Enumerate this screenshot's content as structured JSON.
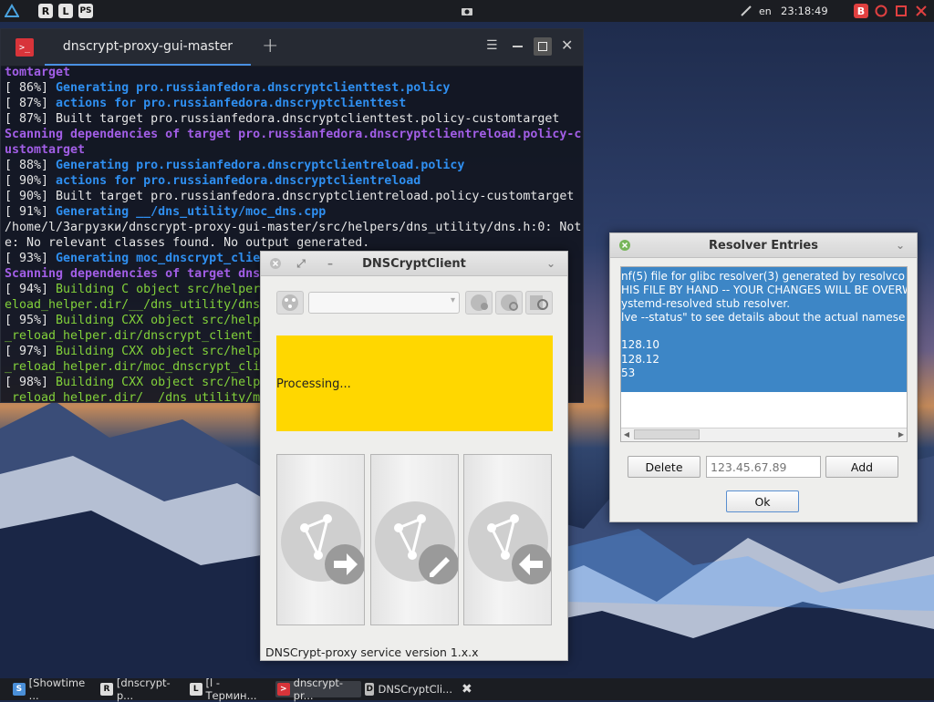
{
  "top_panel": {
    "launchers": [
      "R",
      "L"
    ],
    "keyboard_layout": "en",
    "clock": "23:18:49",
    "tray_badge": "B"
  },
  "terminal": {
    "tab_title": "dnscrypt-proxy-gui-master",
    "new_tab_symbol": "+",
    "lines": [
      {
        "c": "c-p",
        "t": "tomtarget"
      },
      {
        "pre": "[ 86%] ",
        "c": "c-b",
        "t": "Generating pro.russianfedora.dnscryptclienttest.policy"
      },
      {
        "pre": "[ 87%] ",
        "c": "c-b",
        "t": "actions for pro.russianfedora.dnscryptclienttest"
      },
      {
        "pre": "[ 87%] ",
        "c": "c-n",
        "t": "Built target pro.russianfedora.dnscryptclienttest.policy-customtarget"
      },
      {
        "c": "c-p",
        "t": "Scanning dependencies of target pro.russianfedora.dnscryptclientreload.policy-c"
      },
      {
        "c": "c-p",
        "t": "ustomtarget"
      },
      {
        "pre": "[ 88%] ",
        "c": "c-b",
        "t": "Generating pro.russianfedora.dnscryptclientreload.policy"
      },
      {
        "pre": "[ 90%] ",
        "c": "c-b",
        "t": "actions for pro.russianfedora.dnscryptclientreload"
      },
      {
        "pre": "[ 90%] ",
        "c": "c-n",
        "t": "Built target pro.russianfedora.dnscryptclientreload.policy-customtarget"
      },
      {
        "pre": "[ 91%] ",
        "c": "c-b",
        "t": "Generating __/dns_utility/moc_dns.cpp"
      },
      {
        "c": "c-n",
        "t": "/home/l/Загрузки/dnscrypt-proxy-gui-master/src/helpers/dns_utility/dns.h:0: Not"
      },
      {
        "c": "c-n",
        "t": "e: No relevant classes found. No output generated."
      },
      {
        "pre": "[ 93%] ",
        "c": "c-b",
        "t": "Generating moc_dnscrypt_clie"
      },
      {
        "c": "c-p",
        "t": "Scanning dependencies of target dns"
      },
      {
        "pre": "[ 94%] ",
        "c": "c-g",
        "t": "Building C object src/helper                                    _r"
      },
      {
        "c": "c-g",
        "t": "eload_helper.dir/__/dns_utility/dns"
      },
      {
        "pre": "[ 95%] ",
        "c": "c-g",
        "t": "Building CXX object src/helpe                                    nt"
      },
      {
        "c": "c-g",
        "t": "_reload_helper.dir/dnscrypt_client_"
      },
      {
        "pre": "[ 97%] ",
        "c": "c-g",
        "t": "Building CXX object src/helpe                                    nt"
      },
      {
        "c": "c-g",
        "t": "_reload_helper.dir/moc_dnscrypt_clie"
      },
      {
        "pre": "[ 98%] ",
        "c": "c-g",
        "t": "Building CXX object src/helpe                                    nt"
      },
      {
        "c": "c-g",
        "t": "_reload_helper.dir/__/dns_utility/mo"
      }
    ]
  },
  "dnscrypt_window": {
    "title": "DNSCryptClient",
    "status_text": "Processing...",
    "status_color": "#ffd700",
    "footer": "DNSCrypt-proxy service version 1.x.x",
    "big_buttons": [
      "start-service",
      "restart-service",
      "stop-service"
    ]
  },
  "resolver_window": {
    "title": "Resolver Entries",
    "entries_text": "nf(5) file for glibc resolver(3) generated by resolvco\nHIS FILE BY HAND -- YOUR CHANGES WILL BE OVERW\nystemd-resolved stub resolver.\nlve --status\" to see details about the actual namese\n\n128.10\n128.12\n53",
    "delete_label": "Delete",
    "input_placeholder": "123.45.67.89",
    "add_label": "Add",
    "ok_label": "Ok"
  },
  "taskbar": {
    "tasks": [
      {
        "label": "[Showtime ...",
        "icon": "S"
      },
      {
        "label": "[dnscrypt-p...",
        "icon": "R"
      },
      {
        "label": "[l - Термин...",
        "icon": "L"
      },
      {
        "label": "dnscrypt-pr...",
        "icon": ">"
      },
      {
        "label": "DNSCryptCli...",
        "icon": "D"
      }
    ]
  }
}
